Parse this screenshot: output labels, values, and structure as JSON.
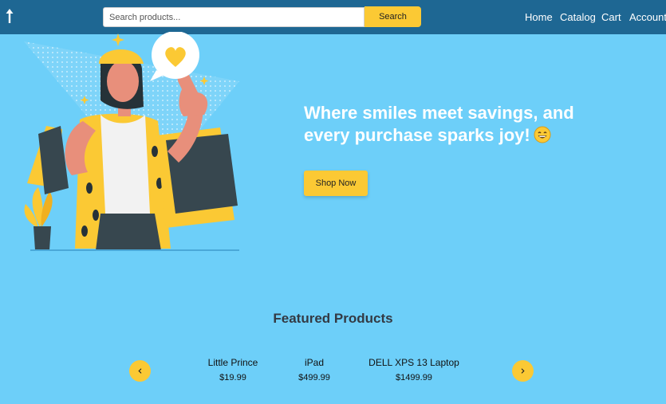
{
  "header": {
    "logo_icon": "arrow-up-icon",
    "search": {
      "placeholder": "Search products...",
      "value": ""
    },
    "search_button": "Search",
    "nav": [
      {
        "label": "Home"
      },
      {
        "label": "Catalog"
      },
      {
        "label": "Cart"
      },
      {
        "label": "Account"
      }
    ]
  },
  "hero": {
    "title": "Where smiles meet savings, and every purchase sparks joy!",
    "emoji_icon": "grinning-face-icon",
    "cta": "Shop Now"
  },
  "featured": {
    "title": "Featured Products",
    "prev_symbol": "‹",
    "next_symbol": "›",
    "products": [
      {
        "name": "Little Prince",
        "price": "$19.99"
      },
      {
        "name": "iPad",
        "price": "$499.99"
      },
      {
        "name": "DELL XPS 13 Laptop",
        "price": "$1499.99"
      }
    ]
  },
  "colors": {
    "page_background": "#6dcff9",
    "navbar": "#1e6793",
    "accent_yellow": "#fbc934",
    "heading_dark": "#333a44"
  }
}
